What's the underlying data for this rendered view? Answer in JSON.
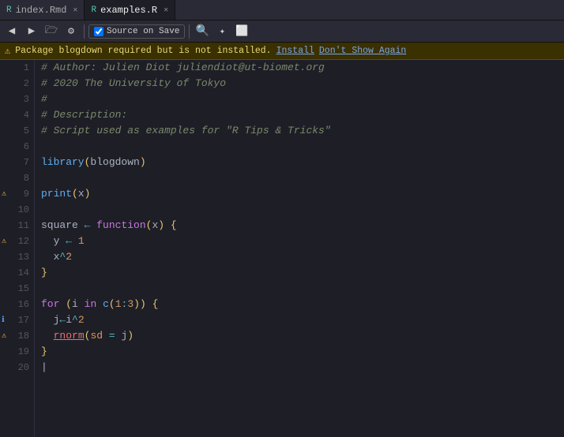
{
  "tabs": [
    {
      "id": "index-rmd",
      "label": "index.Rmd",
      "active": false,
      "icon": "rmd"
    },
    {
      "id": "examples-r",
      "label": "examples.R",
      "active": true,
      "icon": "r"
    }
  ],
  "toolbar": {
    "back_label": "◀",
    "forward_label": "▶",
    "show_in_folder_label": "📁",
    "compile_label": "⚙",
    "source_on_save_label": "Source on Save",
    "search_label": "🔍",
    "spellcheck_label": "✦",
    "fullscreen_label": "⬜"
  },
  "warning_bar": {
    "icon": "⚠",
    "message": "Package blogdown required but is not installed.",
    "install_label": "Install",
    "dont_show_again_label": "Don't Show Again"
  },
  "code": {
    "lines": [
      {
        "num": 1,
        "indicator": "",
        "content_html": "<span class='c-comment'># Author: Julien Diot juliendiot@ut-biomet.org</span>"
      },
      {
        "num": 2,
        "indicator": "",
        "content_html": "<span class='c-comment'># 2020 The University of Tokyo</span>"
      },
      {
        "num": 3,
        "indicator": "",
        "content_html": "<span class='c-comment'>#</span>"
      },
      {
        "num": 4,
        "indicator": "",
        "content_html": "<span class='c-comment'># Description:</span>"
      },
      {
        "num": 5,
        "indicator": "",
        "content_html": "<span class='c-comment'># Script used as examples for \"R Tips &amp; Tricks\"</span>"
      },
      {
        "num": 6,
        "indicator": "",
        "content_html": ""
      },
      {
        "num": 7,
        "indicator": "",
        "content_html": "<span class='c-function'>library</span><span class='c-paren'>(</span><span class='c-plain'>blogdown</span><span class='c-paren'>)</span>"
      },
      {
        "num": 8,
        "indicator": "",
        "content_html": ""
      },
      {
        "num": 9,
        "indicator": "warn",
        "content_html": "<span class='c-function'>print</span><span class='c-paren'>(</span><span class='c-plain'>x</span><span class='c-paren'>)</span>"
      },
      {
        "num": 10,
        "indicator": "",
        "content_html": ""
      },
      {
        "num": 11,
        "indicator": "",
        "content_html": "<span class='c-plain'>square</span> <span class='c-arrow'>←</span> <span class='c-keyword'>function</span><span class='c-paren'>(</span><span class='c-plain'>x</span><span class='c-paren'>)</span> <span class='c-paren'>{</span>"
      },
      {
        "num": 12,
        "indicator": "warn",
        "content_html": "  <span class='c-plain'>y</span> <span class='c-arrow'>←</span> <span class='c-number'>1</span>"
      },
      {
        "num": 13,
        "indicator": "",
        "content_html": "  <span class='c-plain'>x</span><span class='c-operator'>^</span><span class='c-number'>2</span>"
      },
      {
        "num": 14,
        "indicator": "",
        "content_html": "<span class='c-paren'>}</span>"
      },
      {
        "num": 15,
        "indicator": "",
        "content_html": ""
      },
      {
        "num": 16,
        "indicator": "",
        "content_html": "<span class='c-keyword'>for</span> <span class='c-paren'>(</span><span class='c-plain'>i</span> <span class='c-keyword'>in</span> <span class='c-function'>c</span><span class='c-paren'>(</span><span class='c-number'>1</span><span class='c-operator'>:</span><span class='c-number'>3</span><span class='c-paren'>))</span> <span class='c-paren'>{</span>"
      },
      {
        "num": 17,
        "indicator": "info",
        "content_html": "  <span class='c-plain'>j</span><span class='c-arrow'>←</span><span class='c-plain'>i</span><span class='c-operator'>^</span><span class='c-number'>2</span>"
      },
      {
        "num": 18,
        "indicator": "warn",
        "content_html": "  <span class='c-underline'>rnorm</span><span class='c-paren'>(</span><span class='c-param'>sd</span> <span class='c-operator'>=</span> <span class='c-plain'>j</span><span class='c-paren'>)</span>"
      },
      {
        "num": 19,
        "indicator": "",
        "content_html": "<span class='c-paren'>}</span>"
      },
      {
        "num": 20,
        "indicator": "",
        "content_html": "<span class='c-plain'>|</span>"
      }
    ]
  }
}
